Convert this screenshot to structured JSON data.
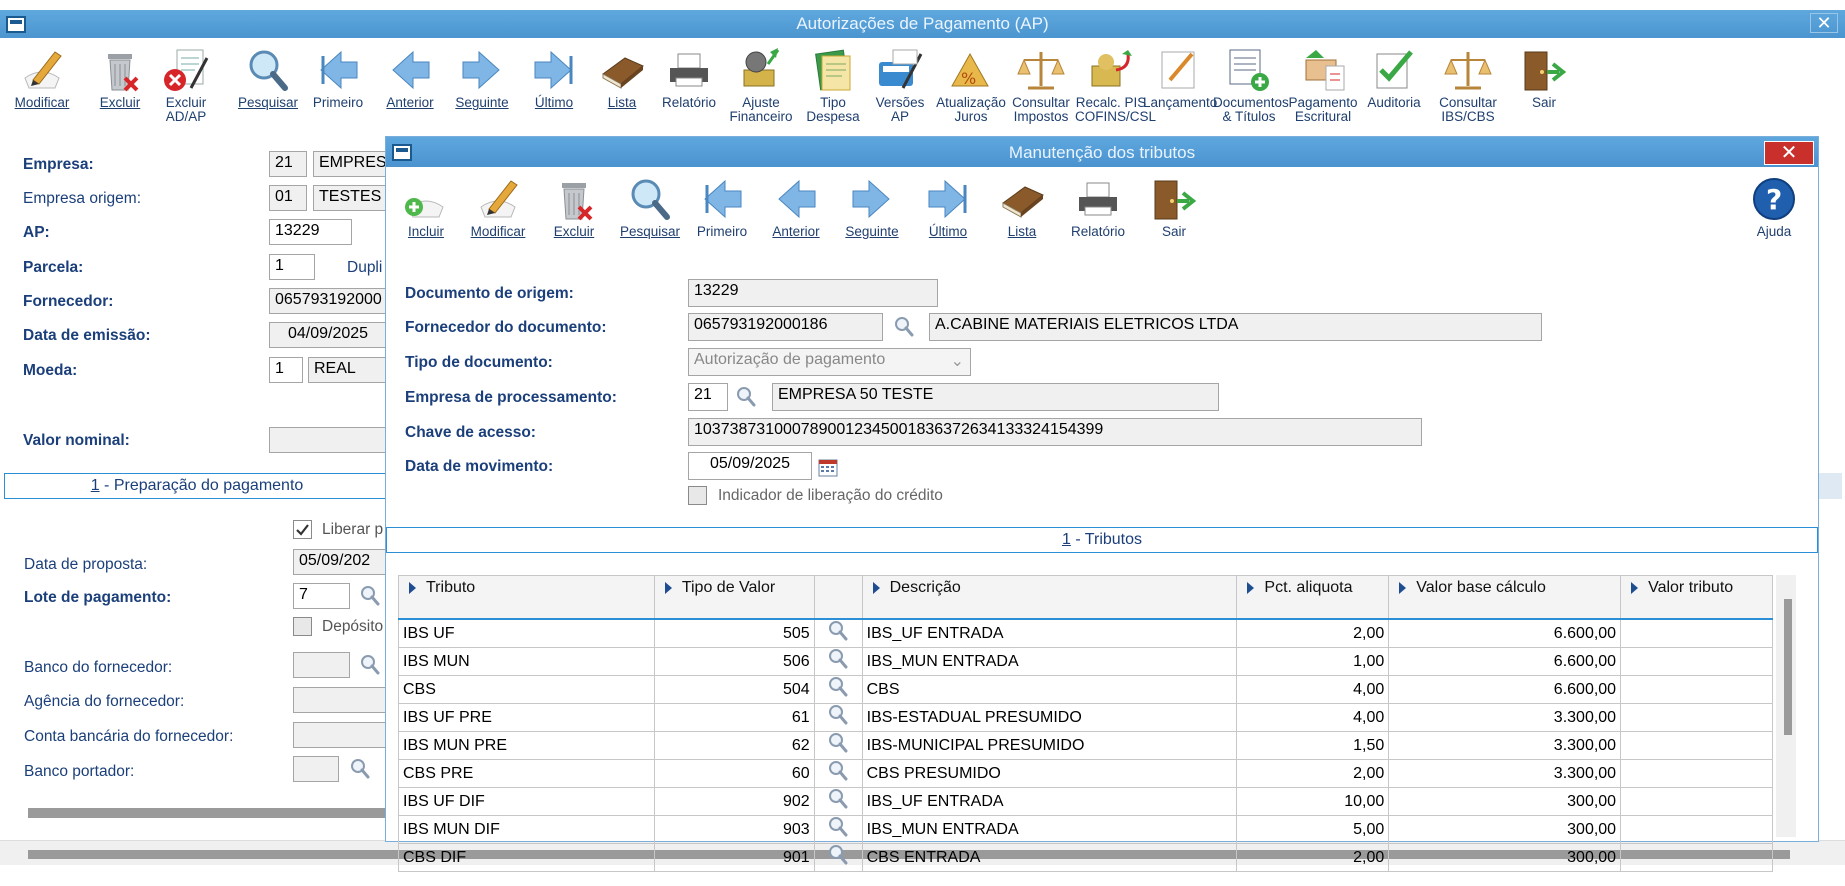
{
  "main": {
    "title": "Autorizações de Pagamento (AP)",
    "toolbar": [
      {
        "label1": "Modificar",
        "label2": "",
        "icon": "edit-icon",
        "ul": "M"
      },
      {
        "label1": "Excluir",
        "label2": "",
        "icon": "trash-icon",
        "ul": "E"
      },
      {
        "label1": "Excluir",
        "label2": "AD/AP",
        "icon": "delete-doc-icon",
        "ul": ""
      },
      {
        "label1": "Pesquisar",
        "label2": "",
        "icon": "search-icon",
        "ul": "P"
      },
      {
        "label1": "Primeiro",
        "label2": "",
        "icon": "first-icon",
        "ul": ""
      },
      {
        "label1": "Anterior",
        "label2": "",
        "icon": "previous-icon",
        "ul": "A"
      },
      {
        "label1": "Seguinte",
        "label2": "",
        "icon": "next-icon",
        "ul": "S"
      },
      {
        "label1": "Último",
        "label2": "",
        "icon": "last-icon",
        "ul": "Ú"
      },
      {
        "label1": "Lista",
        "label2": "",
        "icon": "book-icon",
        "ul": "L"
      },
      {
        "label1": "Relatório",
        "label2": "",
        "icon": "printer-icon",
        "ul": ""
      },
      {
        "label1": "Ajuste",
        "label2": "Financeiro",
        "icon": "money-adjust-icon",
        "ul": ""
      },
      {
        "label1": "Tipo",
        "label2": "Despesa",
        "icon": "expense-type-icon",
        "ul": ""
      },
      {
        "label1": "Versões",
        "label2": "AP",
        "icon": "versions-icon",
        "ul": ""
      },
      {
        "label1": "Atualização",
        "label2": "Juros",
        "icon": "interest-icon",
        "ul": ""
      },
      {
        "label1": "Consultar",
        "label2": "Impostos",
        "icon": "scale-icon",
        "ul": ""
      },
      {
        "label1": "Recalc. PIS",
        "label2": "COFINS/CSL",
        "icon": "recalc-icon",
        "ul": ""
      },
      {
        "label1": "Lançamento",
        "label2": "",
        "icon": "entry-icon",
        "ul": ""
      },
      {
        "label1": "Documentos",
        "label2": "& Títulos",
        "icon": "documents-icon",
        "ul": ""
      },
      {
        "label1": "Pagamento",
        "label2": "Escritural",
        "icon": "payment-icon",
        "ul": ""
      },
      {
        "label1": "Auditoria",
        "label2": "",
        "icon": "audit-icon",
        "ul": ""
      },
      {
        "label1": "Consultar",
        "label2": "IBS/CBS",
        "icon": "scale-icon",
        "ul": ""
      },
      {
        "label1": "Sair",
        "label2": "",
        "icon": "exit-door-icon",
        "ul": ""
      }
    ],
    "fields": {
      "empresa_label": "Empresa:",
      "empresa_code": "21",
      "empresa_name": "EMPRES",
      "empresa_origem_label": "Empresa origem:",
      "empresa_origem_code": "01",
      "empresa_origem_name": "TESTES",
      "ap_label": "AP:",
      "ap_value": "13229",
      "parcela_label": "Parcela:",
      "parcela_value": "1",
      "dupli_label": "Dupli",
      "fornecedor_label": "Fornecedor:",
      "fornecedor_value": "065793192000",
      "data_emissao_label": "Data de emissão:",
      "data_emissao_value": "04/09/2025",
      "moeda_label": "Moeda:",
      "moeda_code": "1",
      "moeda_name": "REAL",
      "valor_nominal_label": "Valor nominal:"
    },
    "tab": {
      "num": "1",
      "text": " - Preparação do pagamento"
    },
    "lower": {
      "liberar_label": "Liberar p",
      "data_proposta_label": "Data de proposta:",
      "data_proposta_value": "05/09/202",
      "lote_label": "Lote de pagamento:",
      "lote_value": "7",
      "deposito_label": "Depósito",
      "banco_fornecedor_label": "Banco do fornecedor:",
      "agencia_label": "Agência do fornecedor:",
      "conta_label": "Conta bancária do fornecedor:",
      "banco_portador_label": "Banco portador:"
    }
  },
  "dialog": {
    "title": "Manutenção dos tributos",
    "toolbar": [
      {
        "label": "Incluir",
        "icon": "add-icon",
        "ul": "I"
      },
      {
        "label": "Modificar",
        "icon": "edit-icon",
        "ul": "M"
      },
      {
        "label": "Excluir",
        "icon": "trash-icon",
        "ul": "E"
      },
      {
        "label": "Pesquisar",
        "icon": "search-icon",
        "ul": "P"
      },
      {
        "label": "Primeiro",
        "icon": "first-icon",
        "ul": ""
      },
      {
        "label": "Anterior",
        "icon": "previous-icon",
        "ul": "A"
      },
      {
        "label": "Seguinte",
        "icon": "next-icon",
        "ul": "S"
      },
      {
        "label": "Último",
        "icon": "last-icon",
        "ul": "Ú"
      },
      {
        "label": "Lista",
        "icon": "book-icon",
        "ul": "L"
      },
      {
        "label": "Relatório",
        "icon": "printer-icon",
        "ul": ""
      },
      {
        "label": "Sair",
        "icon": "exit-door-icon",
        "ul": ""
      }
    ],
    "help_label": "Ajuda",
    "fields": {
      "doc_origem_label": "Documento de origem:",
      "doc_origem_value": "13229",
      "fornecedor_doc_label": "Fornecedor do documento:",
      "fornecedor_doc_code": "065793192000186",
      "fornecedor_doc_name": "A.CABINE MATERIAIS ELETRICOS LTDA",
      "tipo_doc_label": "Tipo de documento:",
      "tipo_doc_value": "Autorização de pagamento",
      "empresa_proc_label": "Empresa de processamento:",
      "empresa_proc_code": "21",
      "empresa_proc_name": "EMPRESA 50 TESTE",
      "chave_label": "Chave de acesso:",
      "chave_value": "10373873100078900123450018363726341333241543​99",
      "data_mov_label": "Data de movimento:",
      "data_mov_value": "05/09/2025",
      "indicador_label": "Indicador de liberação do crédito"
    },
    "tab": {
      "num": "1",
      "text": " - Tributos"
    },
    "table": {
      "headers": [
        "Tributo",
        "Tipo de Valor",
        "",
        "Descrição",
        "Pct. aliquota",
        "Valor base cálculo",
        "Valor tributo"
      ],
      "rows": [
        [
          "IBS UF",
          "505",
          "IBS_UF ENTRADA",
          "2,00",
          "6.600,00",
          ""
        ],
        [
          "IBS MUN",
          "506",
          "IBS_MUN ENTRADA",
          "1,00",
          "6.600,00",
          ""
        ],
        [
          "CBS",
          "504",
          "CBS",
          "4,00",
          "6.600,00",
          ""
        ],
        [
          "IBS UF PRE",
          "61",
          "IBS-ESTADUAL PRESUMIDO",
          "4,00",
          "3.300,00",
          ""
        ],
        [
          "IBS MUN PRE",
          "62",
          "IBS-MUNICIPAL PRESUMIDO",
          "1,50",
          "3.300,00",
          ""
        ],
        [
          "CBS PRE",
          "60",
          "CBS PRESUMIDO",
          "2,00",
          "3.300,00",
          ""
        ],
        [
          "IBS UF DIF",
          "902",
          "IBS_UF ENTRADA",
          "10,00",
          "300,00",
          ""
        ],
        [
          "IBS MUN DIF",
          "903",
          "IBS_MUN ENTRADA",
          "5,00",
          "300,00",
          ""
        ],
        [
          "CBS DIF",
          "901",
          "CBS ENTRADA",
          "2,00",
          "300,00",
          ""
        ]
      ]
    }
  }
}
